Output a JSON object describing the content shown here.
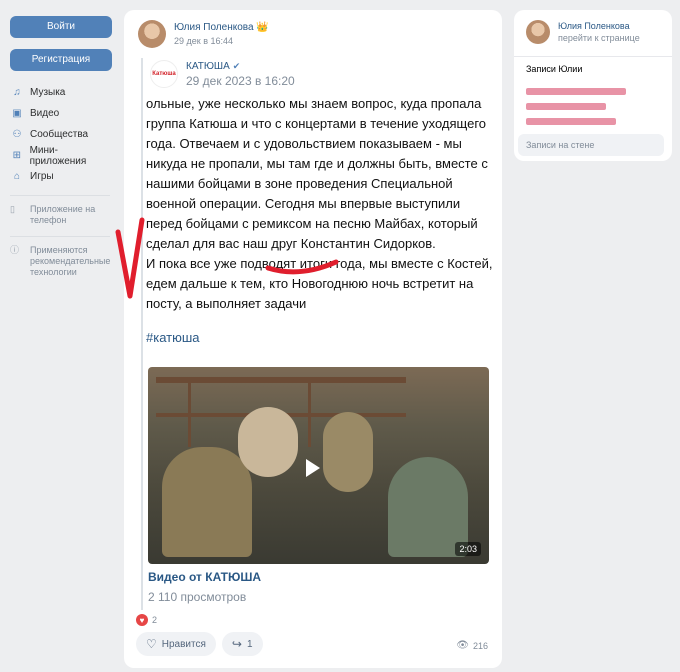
{
  "sidebar": {
    "login_label": "Войти",
    "register_label": "Регистрация",
    "items": [
      {
        "label": "Музыка",
        "icon": "music-icon"
      },
      {
        "label": "Видео",
        "icon": "video-icon"
      },
      {
        "label": "Сообщества",
        "icon": "communities-icon"
      },
      {
        "label": "Мини-приложения",
        "icon": "apps-icon"
      },
      {
        "label": "Игры",
        "icon": "games-icon"
      }
    ],
    "note_phone": "Приложение на телефон",
    "note_tech": "Применяются рекомендательные технологии"
  },
  "post": {
    "author": "Юлия Поленкова",
    "author_badge": "👑",
    "date": "29 дек в 16:44",
    "repost_source": "КАТЮША",
    "repost_logo_text": "Катюша",
    "repost_date": "29 дек 2023 в 16:20",
    "paragraph1": "ольные, уже несколько мы знаем вопрос, куда пропала группа Катюша и что с концертами в течение уходящего года. Отвечаем и с удовольствием показываем - мы никуда не пропали, мы там где и должны быть, вместе с нашими бойцами в зоне проведения Специальной военной операции. Сегодня мы впервые выступили перед бойцами с ремиксом на песню Майбах, который сделал для вас наш друг Константин Сидорков.",
    "paragraph2": "И пока все уже подводят итоги года, мы вместе с Костей, едем дальше к тем, кто Новогоднюю ночь встретит на посту, а выполняет задачи",
    "hashtag": "#катюша",
    "video_duration": "2:03",
    "video_title": "Видео от КАТЮША",
    "video_views": "2 110 просмотров",
    "reactions_count": "2",
    "like_label": "Нравится",
    "share_count": "1",
    "views_count": "216"
  },
  "right_panel": {
    "name": "Юлия Поленкова",
    "link": "перейти к странице",
    "section": "Записи Юлии",
    "footer": "Записи на стене"
  },
  "colors": {
    "accent": "#5181b8",
    "link": "#2a5885",
    "background": "#edeef0",
    "annotation": "#e01e2d"
  }
}
